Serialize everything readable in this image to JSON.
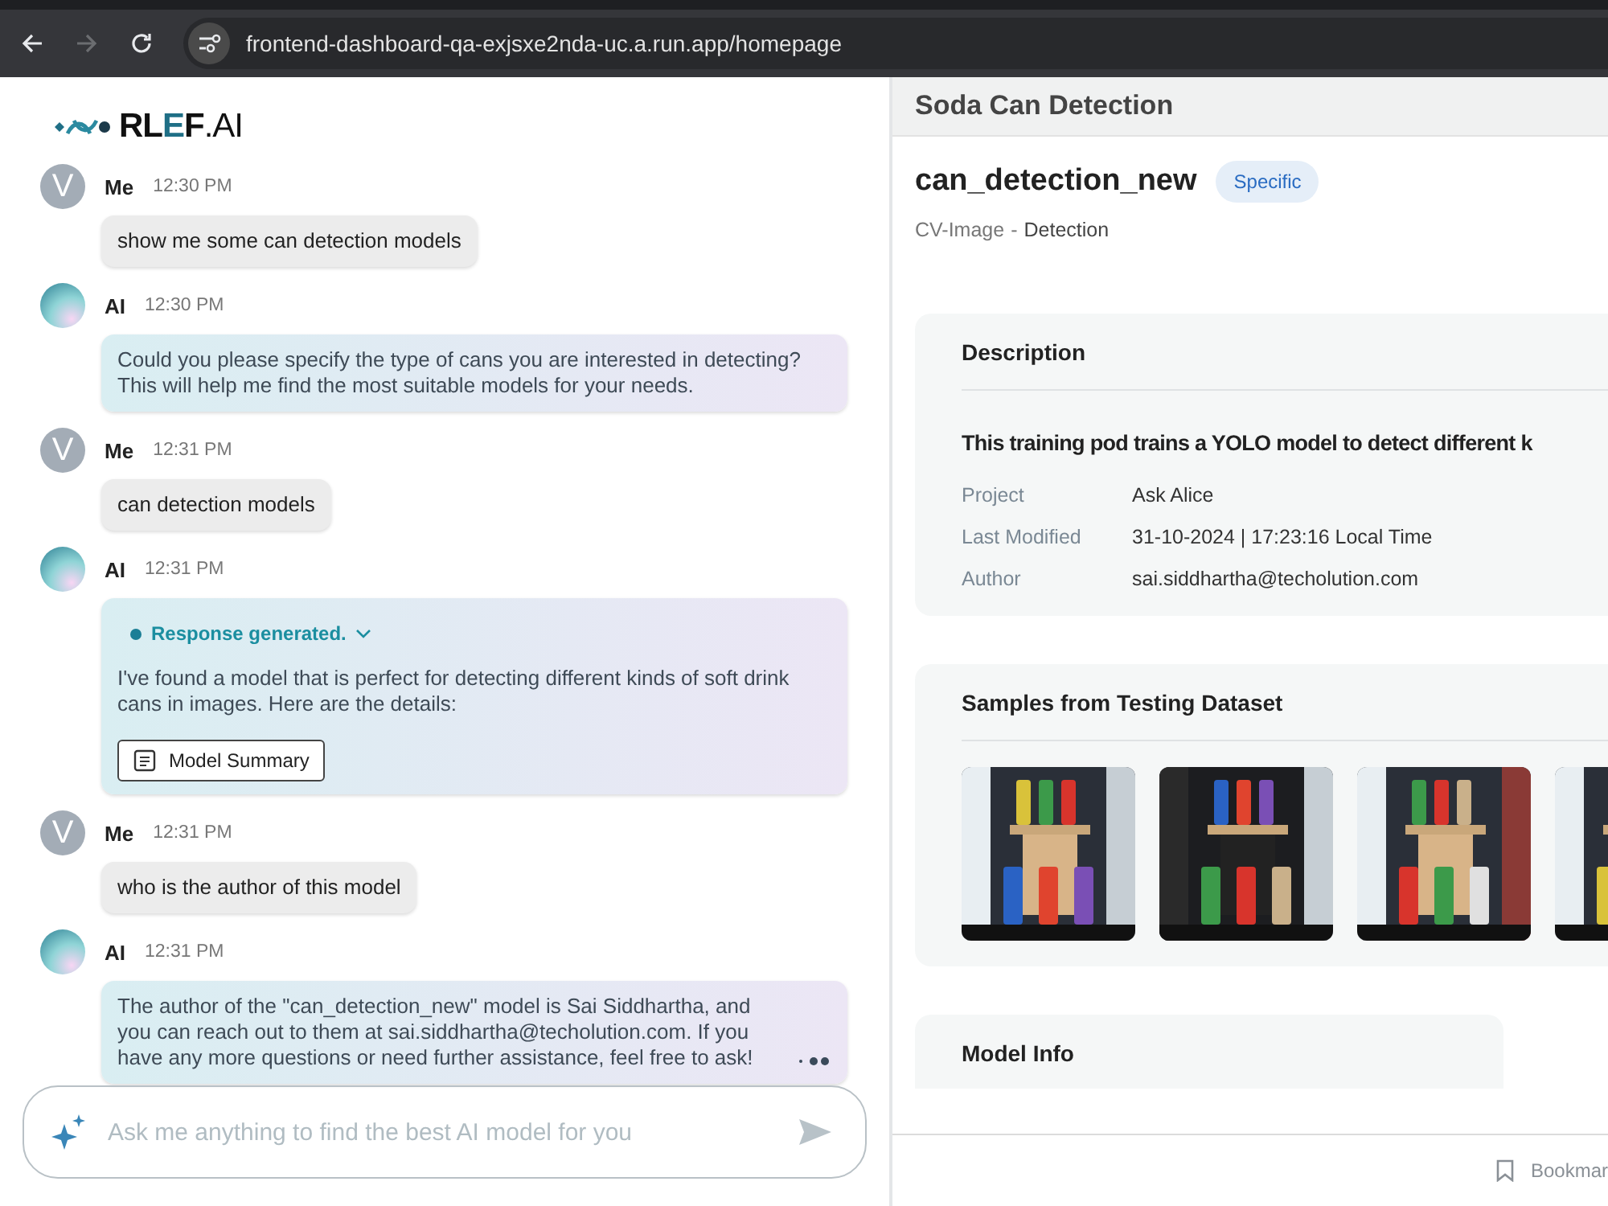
{
  "browser": {
    "url": "frontend-dashboard-qa-exjsxe2nda-uc.a.run.app/homepage",
    "forward_disabled": true
  },
  "logo": {
    "text_dark": "RL",
    "text_accent": "E",
    "text_end": "F",
    "suffix": ".AI"
  },
  "messages": [
    {
      "kind": "user",
      "avatar_letter": "V",
      "sender": "Me",
      "time": "12:30 PM",
      "text": "show me some can detection models"
    },
    {
      "kind": "ai",
      "sender": "AI",
      "time": "12:30 PM",
      "text": "Could you please specify the type of cans you are interested in detecting? This will help me find the most suitable models for your needs."
    },
    {
      "kind": "user",
      "avatar_letter": "V",
      "sender": "Me",
      "time": "12:31 PM",
      "text": "can detection models"
    },
    {
      "kind": "ai",
      "sender": "AI",
      "time": "12:31 PM",
      "status": "Response generated.",
      "text": "I've found a model that is perfect for detecting different kinds of soft drink cans in images. Here are the details:",
      "button": "Model Summary"
    },
    {
      "kind": "user",
      "avatar_letter": "V",
      "sender": "Me",
      "time": "12:31 PM",
      "text": "who is the author of this model"
    },
    {
      "kind": "ai",
      "sender": "AI",
      "time": "12:31 PM",
      "text": "The author of the \"can_detection_new\" model is Sai Siddhartha, and you can reach out to them at sai.siddhartha@techolution.com. If you have any more questions or need further assistance, feel free to ask!",
      "typing": true
    }
  ],
  "chat_input": {
    "placeholder": "Ask me anything to find the best AI model for you"
  },
  "detail": {
    "header": "Soda Can Detection",
    "model_name": "can_detection_new",
    "tag": "Specific",
    "category": "CV-Image",
    "separator": "-",
    "task": "Detection",
    "description": {
      "title": "Description",
      "text": "This training pod trains a YOLO model to detect different k",
      "fields": [
        {
          "label": "Project",
          "value": "Ask Alice"
        },
        {
          "label": "Last Modified",
          "value": "31-10-2024 | 17:23:16 Local Time"
        },
        {
          "label": "Author",
          "value": "sai.siddhartha@techolution.com"
        }
      ]
    },
    "samples": {
      "title": "Samples from Testing Dataset"
    },
    "model_info": {
      "title": "Model Info"
    },
    "footer": {
      "bookmark": "Bookmar"
    }
  }
}
